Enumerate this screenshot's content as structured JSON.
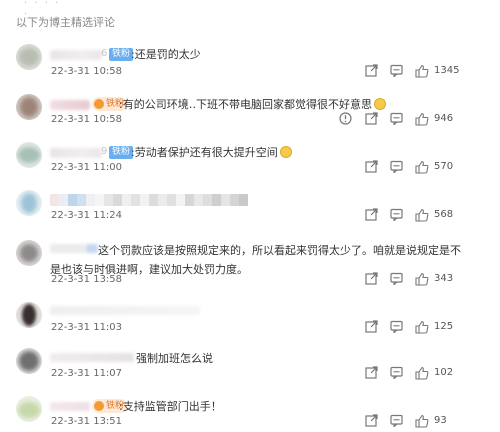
{
  "section_header": "以下为博主精选评论",
  "comments": [
    {
      "name_suffix": "6",
      "badge": "铁粉",
      "text": ":还是罚的太少",
      "time": "22-3-31 10:58",
      "likes": "1345",
      "has_report": false
    },
    {
      "name_suffix": "",
      "badge_gold": "铁粉",
      "text": ":有的公司环境‥下班不带电脑回家都觉得很不好意思",
      "time": "22-3-31 10:58",
      "likes": "946",
      "has_report": true
    },
    {
      "name_suffix": "9",
      "badge": "铁粉",
      "text": ":劳动者保护还有很大提升空间",
      "time": "22-3-31 11:00",
      "likes": "570",
      "has_report": false
    },
    {
      "name_suffix": "",
      "text": "",
      "time": "22-3-31 11:24",
      "likes": "568",
      "has_report": false
    },
    {
      "name_suffix": "",
      "text": "这个罚款应该是按照规定来的，所以看起来罚得太少了。咱就是说规定是不是也该与时俱进啊，建议加大处罚力度。",
      "time": "22-3-31 13:58",
      "likes": "343",
      "has_report": false
    },
    {
      "name_suffix": "",
      "text": "",
      "time": "22-3-31 11:03",
      "likes": "125",
      "has_report": false
    },
    {
      "name_suffix": "",
      "text": "强制加班怎么说",
      "time": "22-3-31 11:07",
      "likes": "102",
      "has_report": false
    },
    {
      "name_suffix": "",
      "badge_gold": "铁粉",
      "text": ":支持监管部门出手！",
      "time": "22-3-31 13:51",
      "likes": "93",
      "has_report": false
    }
  ],
  "icons": {
    "share": "share-icon",
    "comment": "comment-icon",
    "like": "thumbs-up-icon",
    "report": "report-icon"
  }
}
